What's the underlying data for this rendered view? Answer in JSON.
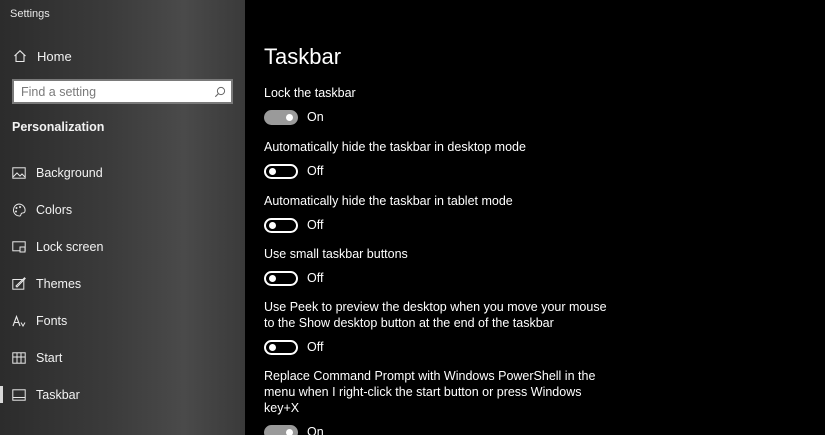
{
  "window": {
    "title": "Settings"
  },
  "sidebar": {
    "home_label": "Home",
    "search_placeholder": "Find a setting",
    "section_title": "Personalization",
    "items": [
      {
        "label": "Background",
        "icon": "background-icon",
        "active": false
      },
      {
        "label": "Colors",
        "icon": "palette-icon",
        "active": false
      },
      {
        "label": "Lock screen",
        "icon": "lock-screen-icon",
        "active": false
      },
      {
        "label": "Themes",
        "icon": "themes-icon",
        "active": false
      },
      {
        "label": "Fonts",
        "icon": "fonts-icon",
        "active": false
      },
      {
        "label": "Start",
        "icon": "start-icon",
        "active": false
      },
      {
        "label": "Taskbar",
        "icon": "taskbar-icon",
        "active": true
      }
    ]
  },
  "main": {
    "title": "Taskbar",
    "settings": [
      {
        "label": "Lock the taskbar",
        "state": "On",
        "on": true
      },
      {
        "label": "Automatically hide the taskbar in desktop mode",
        "state": "Off",
        "on": false
      },
      {
        "label": "Automatically hide the taskbar in tablet mode",
        "state": "Off",
        "on": false
      },
      {
        "label": "Use small taskbar buttons",
        "state": "Off",
        "on": false
      },
      {
        "label": "Use Peek to preview the desktop when you move your mouse to the Show desktop button at the end of the taskbar",
        "state": "Off",
        "on": false
      },
      {
        "label": "Replace Command Prompt with Windows PowerShell in the menu when I right-click the start button or press Windows key+X",
        "state": "On",
        "on": true
      }
    ]
  },
  "colors": {
    "sidebar_text": "#f2f2f2",
    "toggle_on": "#9a9a9a",
    "background": "#000000"
  }
}
